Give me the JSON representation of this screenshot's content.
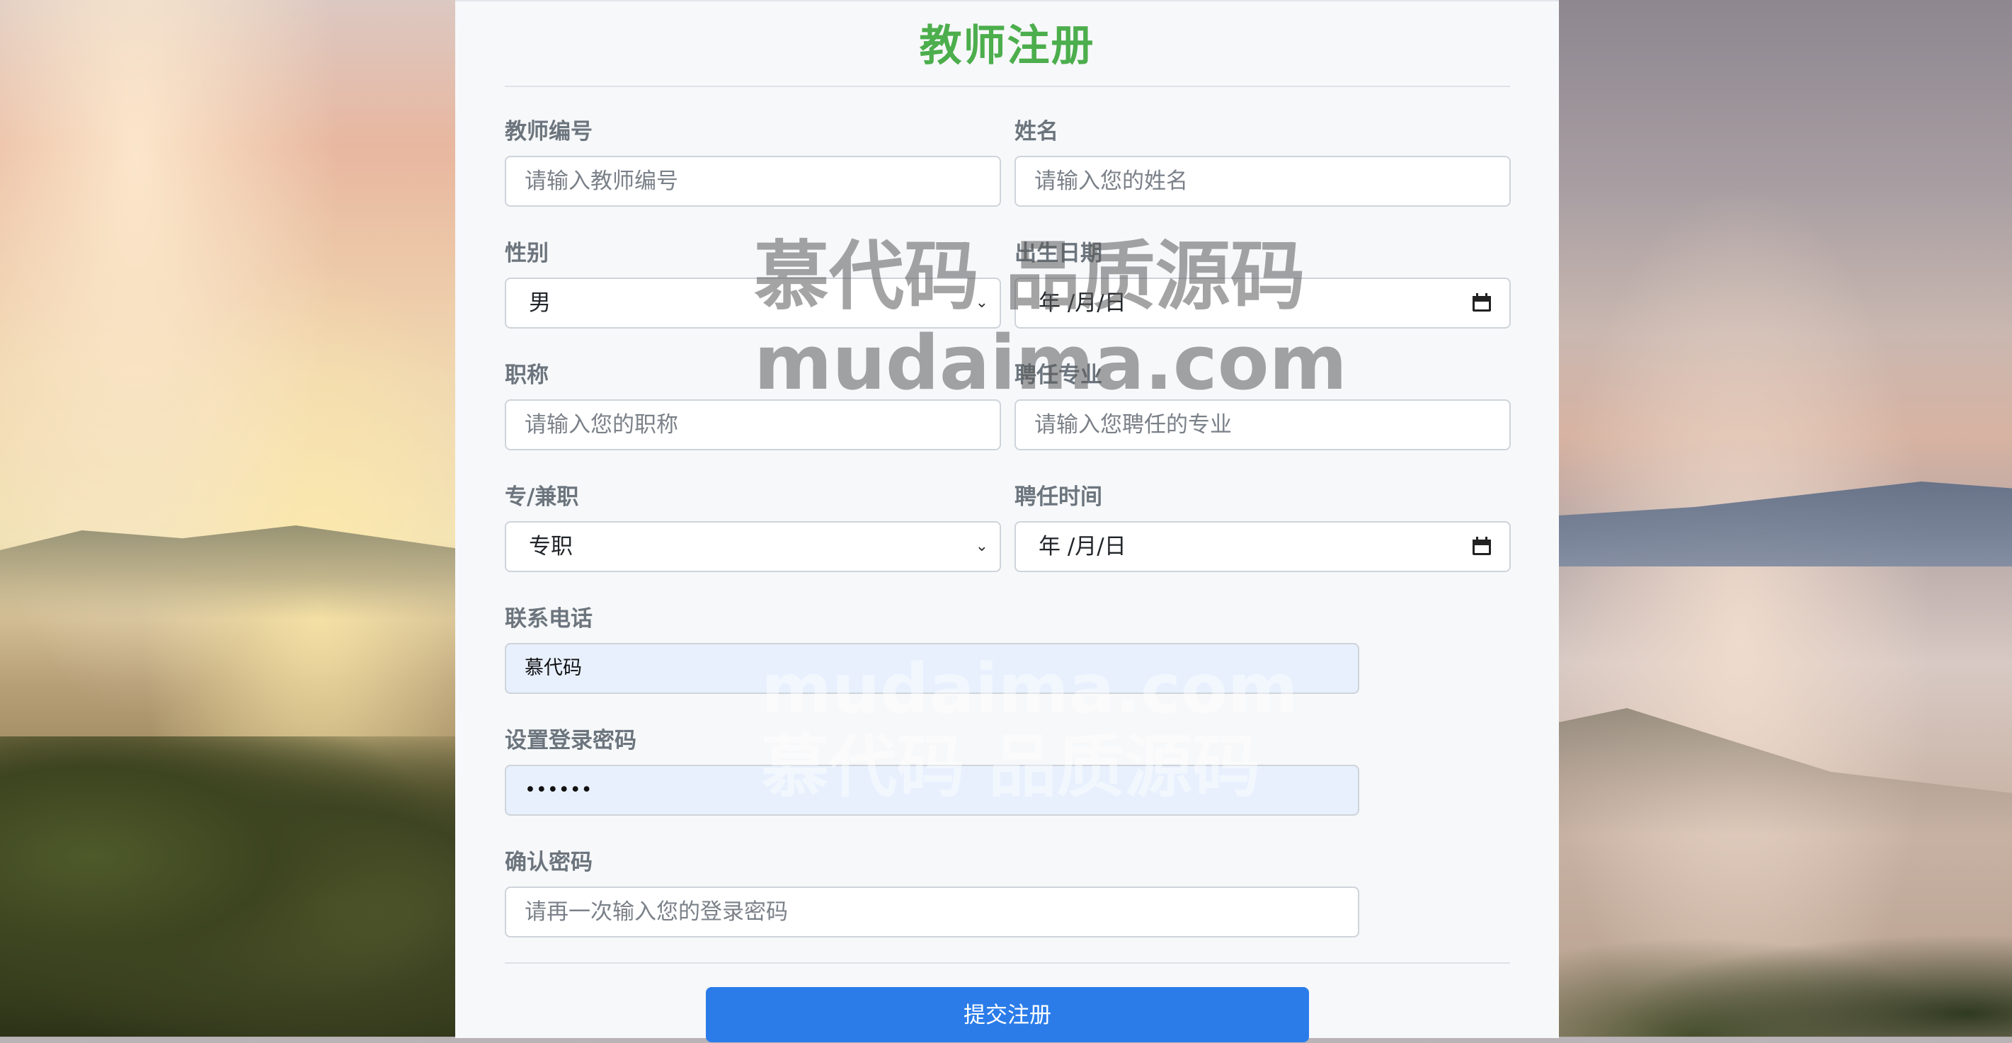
{
  "form": {
    "title": "教师注册",
    "teacher_id": {
      "label": "教师编号",
      "placeholder": "请输入教师编号"
    },
    "name": {
      "label": "姓名",
      "placeholder": "请输入您的姓名"
    },
    "gender": {
      "label": "性别",
      "value": "男"
    },
    "birth_date": {
      "label": "出生日期",
      "value": "年 /月/日"
    },
    "job_title": {
      "label": "职称",
      "placeholder": "请输入您的职称"
    },
    "major": {
      "label": "聘任专业",
      "placeholder": "请输入您聘任的专业"
    },
    "employment_type": {
      "label": "专/兼职",
      "value": "专职"
    },
    "hire_date": {
      "label": "聘任时间",
      "value": "年 /月/日"
    },
    "phone": {
      "label": "联系电话",
      "value": "慕代码"
    },
    "password": {
      "label": "设置登录密码",
      "value": "••••••"
    },
    "confirm_password": {
      "label": "确认密码",
      "placeholder": "请再一次输入您的登录密码"
    },
    "submit_label": "提交注册"
  },
  "watermarks": {
    "primary_line1": "慕代码 品质源码",
    "primary_line2": "mudaima.com",
    "secondary_line1": "mudaima.com",
    "secondary_line2": "慕代码 品质源码"
  },
  "colors": {
    "title": "#4cae4c",
    "button": "#2b7ce9",
    "autofill": "#e8f0fe"
  },
  "icons": [
    "chevron-down-icon",
    "calendar-icon"
  ]
}
